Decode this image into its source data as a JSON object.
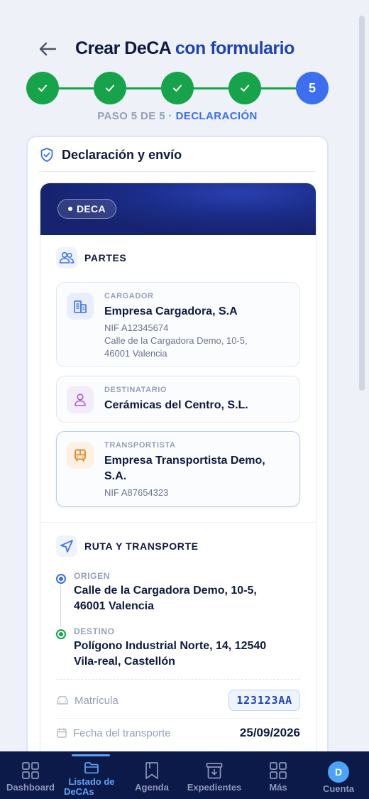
{
  "header": {
    "title_part1": "Crear DeCA",
    "title_part2": "con formulario"
  },
  "stepper": {
    "current_step_number": "5",
    "caption_part1": "PASO 5 DE 5 ·",
    "caption_part2": "DECLARACIÓN",
    "steps_completed": 4,
    "steps_total": 5
  },
  "card": {
    "title": "Declaración y envío",
    "badge": "DECA",
    "partes": {
      "title": "PARTES",
      "cargador": {
        "role": "CARGADOR",
        "name": "Empresa Cargadora, S.A",
        "nif": "NIF A12345674",
        "address_line1": "Calle de la Cargadora Demo, 10-5,",
        "address_line2": "46001 Valencia"
      },
      "destinatario": {
        "role": "DESTINATARIO",
        "name": "Cerámicas del Centro, S.L."
      },
      "transportista": {
        "role": "TRANSPORTISTA",
        "name_line1": "Empresa Transportista Demo,",
        "name_line2": "S.A.",
        "nif": "NIF A87654323"
      }
    },
    "ruta": {
      "title": "RUTA Y TRANSPORTE",
      "origen_label": "ORIGEN",
      "origen_line1": "Calle de la Cargadora Demo, 10-5,",
      "origen_line2": "46001 Valencia",
      "destino_label": "DESTINO",
      "destino_line1": "Polígono Industrial Norte, 14, 12540",
      "destino_line2": "Vila-real, Castellón",
      "matricula_label": "Matrícula",
      "matricula_value": "123123AA",
      "fecha_label": "Fecha del transporte",
      "fecha_value": "25/09/2026"
    }
  },
  "bottom_nav": {
    "items": [
      {
        "label": "Dashboard",
        "icon": "grid-icon"
      },
      {
        "label_line1": "Listado de",
        "label_line2": "DeCAs",
        "icon": "folder-icon",
        "active": true
      },
      {
        "label": "Agenda",
        "icon": "bookmark-icon"
      },
      {
        "label": "Expedientes",
        "icon": "archive-icon"
      },
      {
        "label": "Más",
        "icon": "grid-icon"
      },
      {
        "label": "Cuenta",
        "icon": "avatar",
        "avatar_initial": "D"
      }
    ]
  },
  "colors": {
    "primary": "#1f43b4",
    "accent": "#3b6ff0",
    "success": "#16a34a",
    "nav_bg": "#0c1a4a",
    "nav_active": "#5ea2f5"
  }
}
